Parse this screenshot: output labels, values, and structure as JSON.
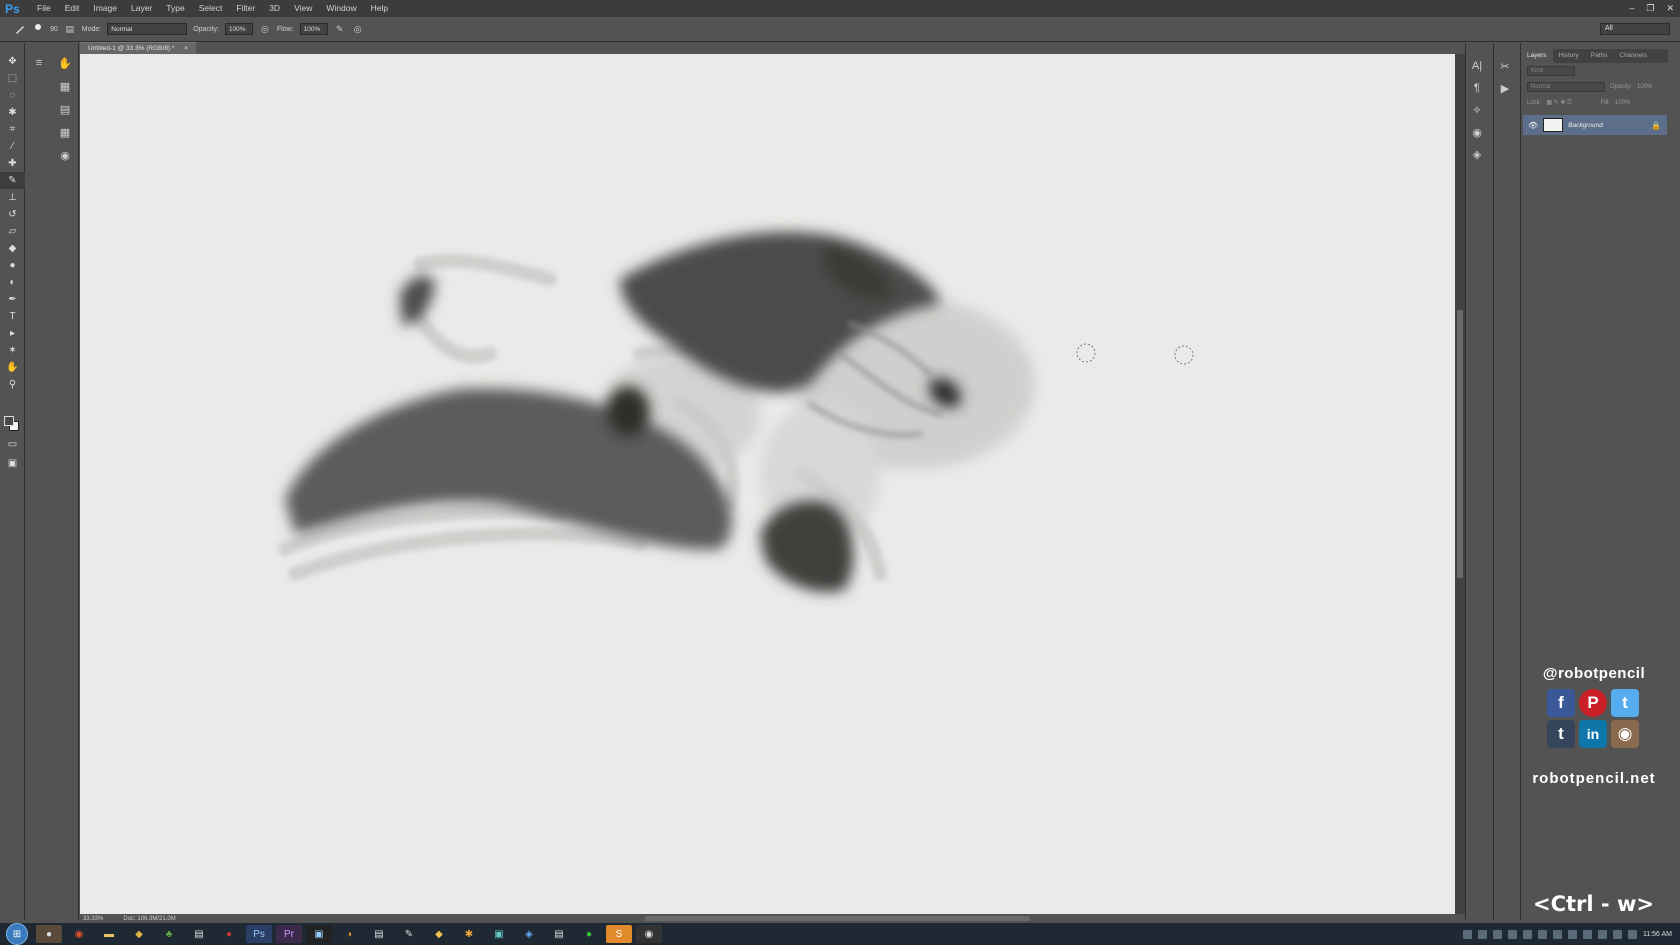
{
  "app": {
    "logo": "Ps",
    "accent": "#3aa0f5"
  },
  "menu": [
    "File",
    "Edit",
    "Image",
    "Layer",
    "Type",
    "Select",
    "Filter",
    "3D",
    "View",
    "Window",
    "Help"
  ],
  "window_controls": [
    "–",
    "❐",
    "✕"
  ],
  "options": {
    "mode_label": "Mode:",
    "mode_value": "Normal",
    "opacity_label": "Opacity:",
    "opacity_value": "100%",
    "flow_label": "Flow:",
    "flow_value": "100%",
    "brush_size": "90",
    "workspace": "All"
  },
  "document": {
    "tab_title": "Untitled-1 @ 33.3% (RGB/8) *"
  },
  "status": {
    "zoom": "33.33%",
    "doc_size": "Doc: 106.3M/21.0M"
  },
  "layers_panel": {
    "tabs": [
      "Layers",
      "History",
      "Paths",
      "Channels"
    ],
    "kind_label": "Kind",
    "blend": "Normal",
    "opacity_label": "Opacity:",
    "opacity_value": "100%",
    "lock_label": "Lock:",
    "fill_label": "Fill:",
    "fill_value": "100%",
    "layer_name": "Background"
  },
  "social": {
    "handle": "@robotpencil",
    "site": "robotpencil.net",
    "icons": [
      {
        "name": "facebook-icon",
        "glyph": "f",
        "color": "#3b5998"
      },
      {
        "name": "pinterest-icon",
        "glyph": "P",
        "color": "#cb2027"
      },
      {
        "name": "twitter-icon",
        "glyph": "t",
        "color": "#55acee"
      },
      {
        "name": "tumblr-icon",
        "glyph": "t",
        "color": "#35465c"
      },
      {
        "name": "linkedin-icon",
        "glyph": "in",
        "color": "#0e76a8"
      },
      {
        "name": "instagram-icon",
        "glyph": "◉",
        "color": "#8a6a4e"
      }
    ]
  },
  "shortcut_overlay": "<Ctrl - w>",
  "taskbar": {
    "time": "11:56 AM"
  }
}
